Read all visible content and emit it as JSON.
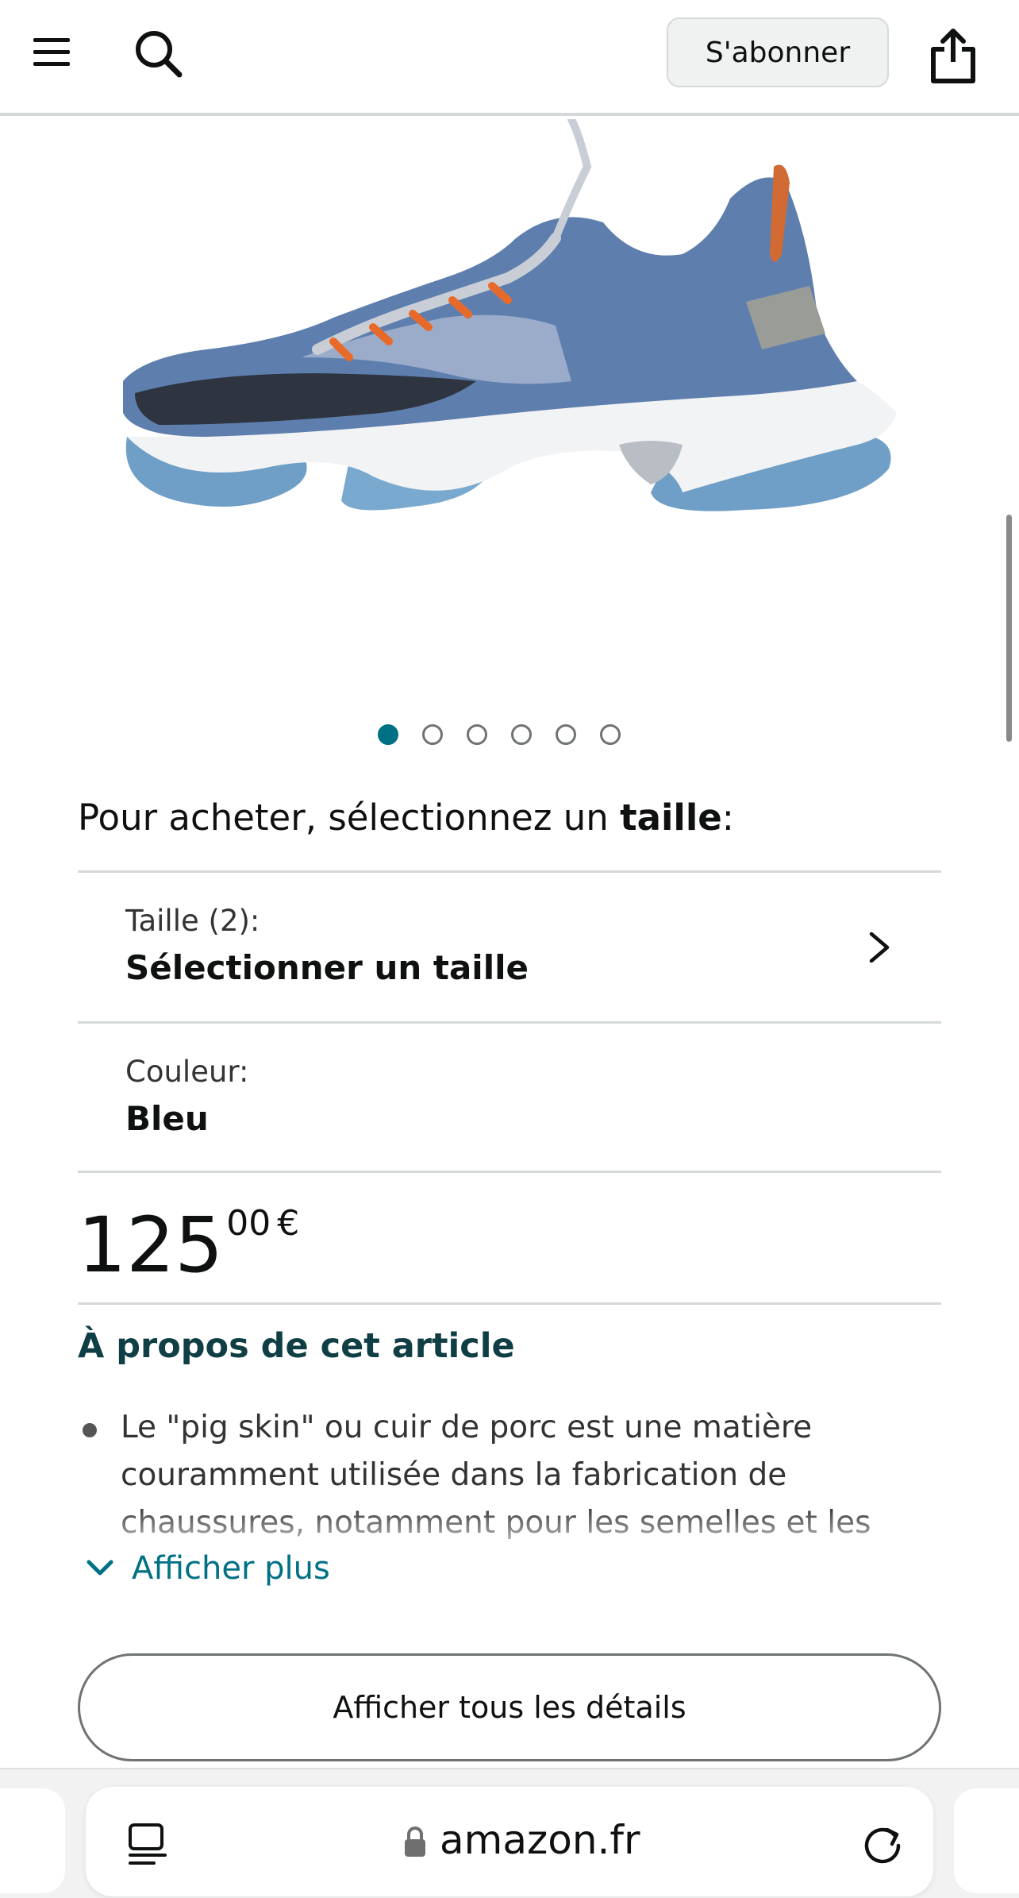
{
  "header": {
    "subscribe_label": "S'abonner",
    "icons": [
      "menu-icon",
      "search-icon",
      "share-icon"
    ]
  },
  "gallery": {
    "image_count": 6,
    "active_index": 0,
    "accent_color": "#007185"
  },
  "selection": {
    "prompt_prefix": "Pour acheter, sélectionnez un ",
    "prompt_bold": "taille",
    "prompt_suffix": ":",
    "size_label": "Taille (2):",
    "size_value": "Sélectionner un taille",
    "color_label": "Couleur:",
    "color_value": "Bleu"
  },
  "price": {
    "whole": "125",
    "fraction": "00",
    "currency": "€"
  },
  "about": {
    "title": "À propos de cet article",
    "bullet_text": "Le \"pig skin\" ou cuir de porc est une matière couramment utilisée dans la fabrication de chaussures, notamment pour les semelles et les",
    "show_more_label": "Afficher plus"
  },
  "details_button_label": "Afficher tous les détails",
  "browser": {
    "url": "amazon.fr",
    "icons": [
      "reader-icon",
      "lock-icon",
      "reload-icon"
    ]
  }
}
